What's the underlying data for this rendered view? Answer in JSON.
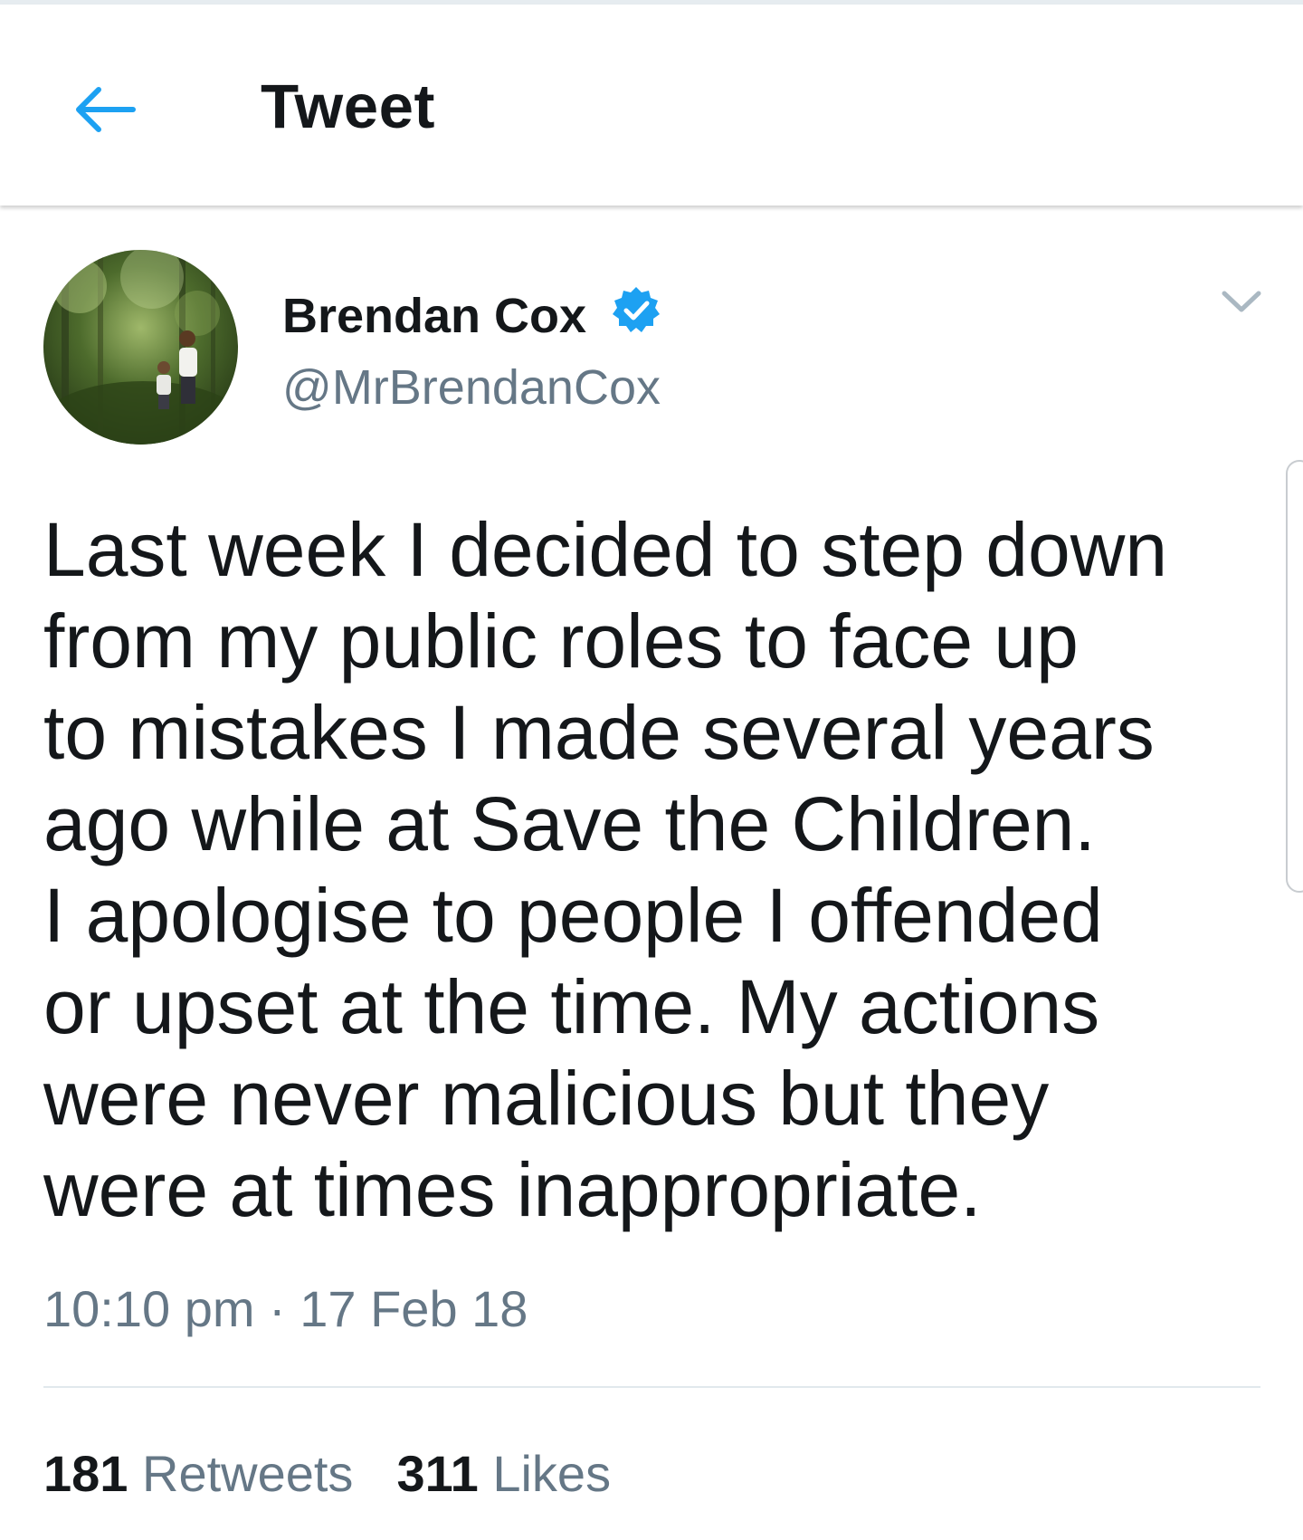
{
  "header": {
    "title": "Tweet"
  },
  "tweet": {
    "author_name": "Brendan Cox",
    "handle": "@MrBrendanCox",
    "verified": true,
    "text_lines": [
      "Last week I decided to step down",
      "from my public roles to face up",
      "to mistakes I made several years",
      "ago while at Save the Children.",
      "I apologise to people I offended",
      "or upset at the time. My actions",
      "were never malicious but they",
      "were at times inappropriate."
    ],
    "timestamp": "10:10 pm · 17 Feb 18",
    "retweets": {
      "count": "181",
      "label": "Retweets"
    },
    "likes": {
      "count": "311",
      "label": "Likes"
    }
  },
  "icons": {
    "back": "back-arrow-icon",
    "verified": "verified-badge-icon",
    "more": "chevron-down-icon"
  },
  "colors": {
    "accent": "#1da1f2",
    "text_primary": "#14171a",
    "text_secondary": "#657786",
    "divider": "#e1e8ed"
  }
}
